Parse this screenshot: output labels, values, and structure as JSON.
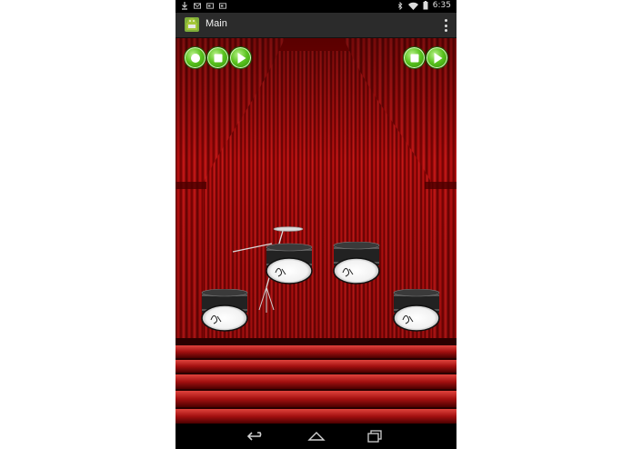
{
  "status_bar": {
    "time": "6:35",
    "left_icons": [
      "download-icon",
      "gmail-icon",
      "photos-icon",
      "photos-icon"
    ],
    "right_icons": [
      "bluetooth-icon",
      "wifi-icon",
      "battery-icon"
    ]
  },
  "action_bar": {
    "title": "Main",
    "app_icon": "android-icon",
    "menu_icon": "overflow-menu-icon"
  },
  "controls": {
    "left": [
      "record-icon",
      "stop-icon",
      "play-icon"
    ],
    "right": [
      "stop-icon",
      "play-icon"
    ]
  },
  "scene": {
    "background": "red-stage-curtain",
    "drums": [
      "drum-kit-tom",
      "drum-center-right",
      "drum-bottom-left",
      "drum-bottom-right"
    ]
  },
  "navigation": [
    "back-icon",
    "home-icon",
    "recent-apps-icon"
  ],
  "colors": {
    "curtain": "#b10c0c",
    "curtain_dark": "#5a0000",
    "button_green": "#59c21e",
    "action_bar": "#2b2b2b"
  }
}
